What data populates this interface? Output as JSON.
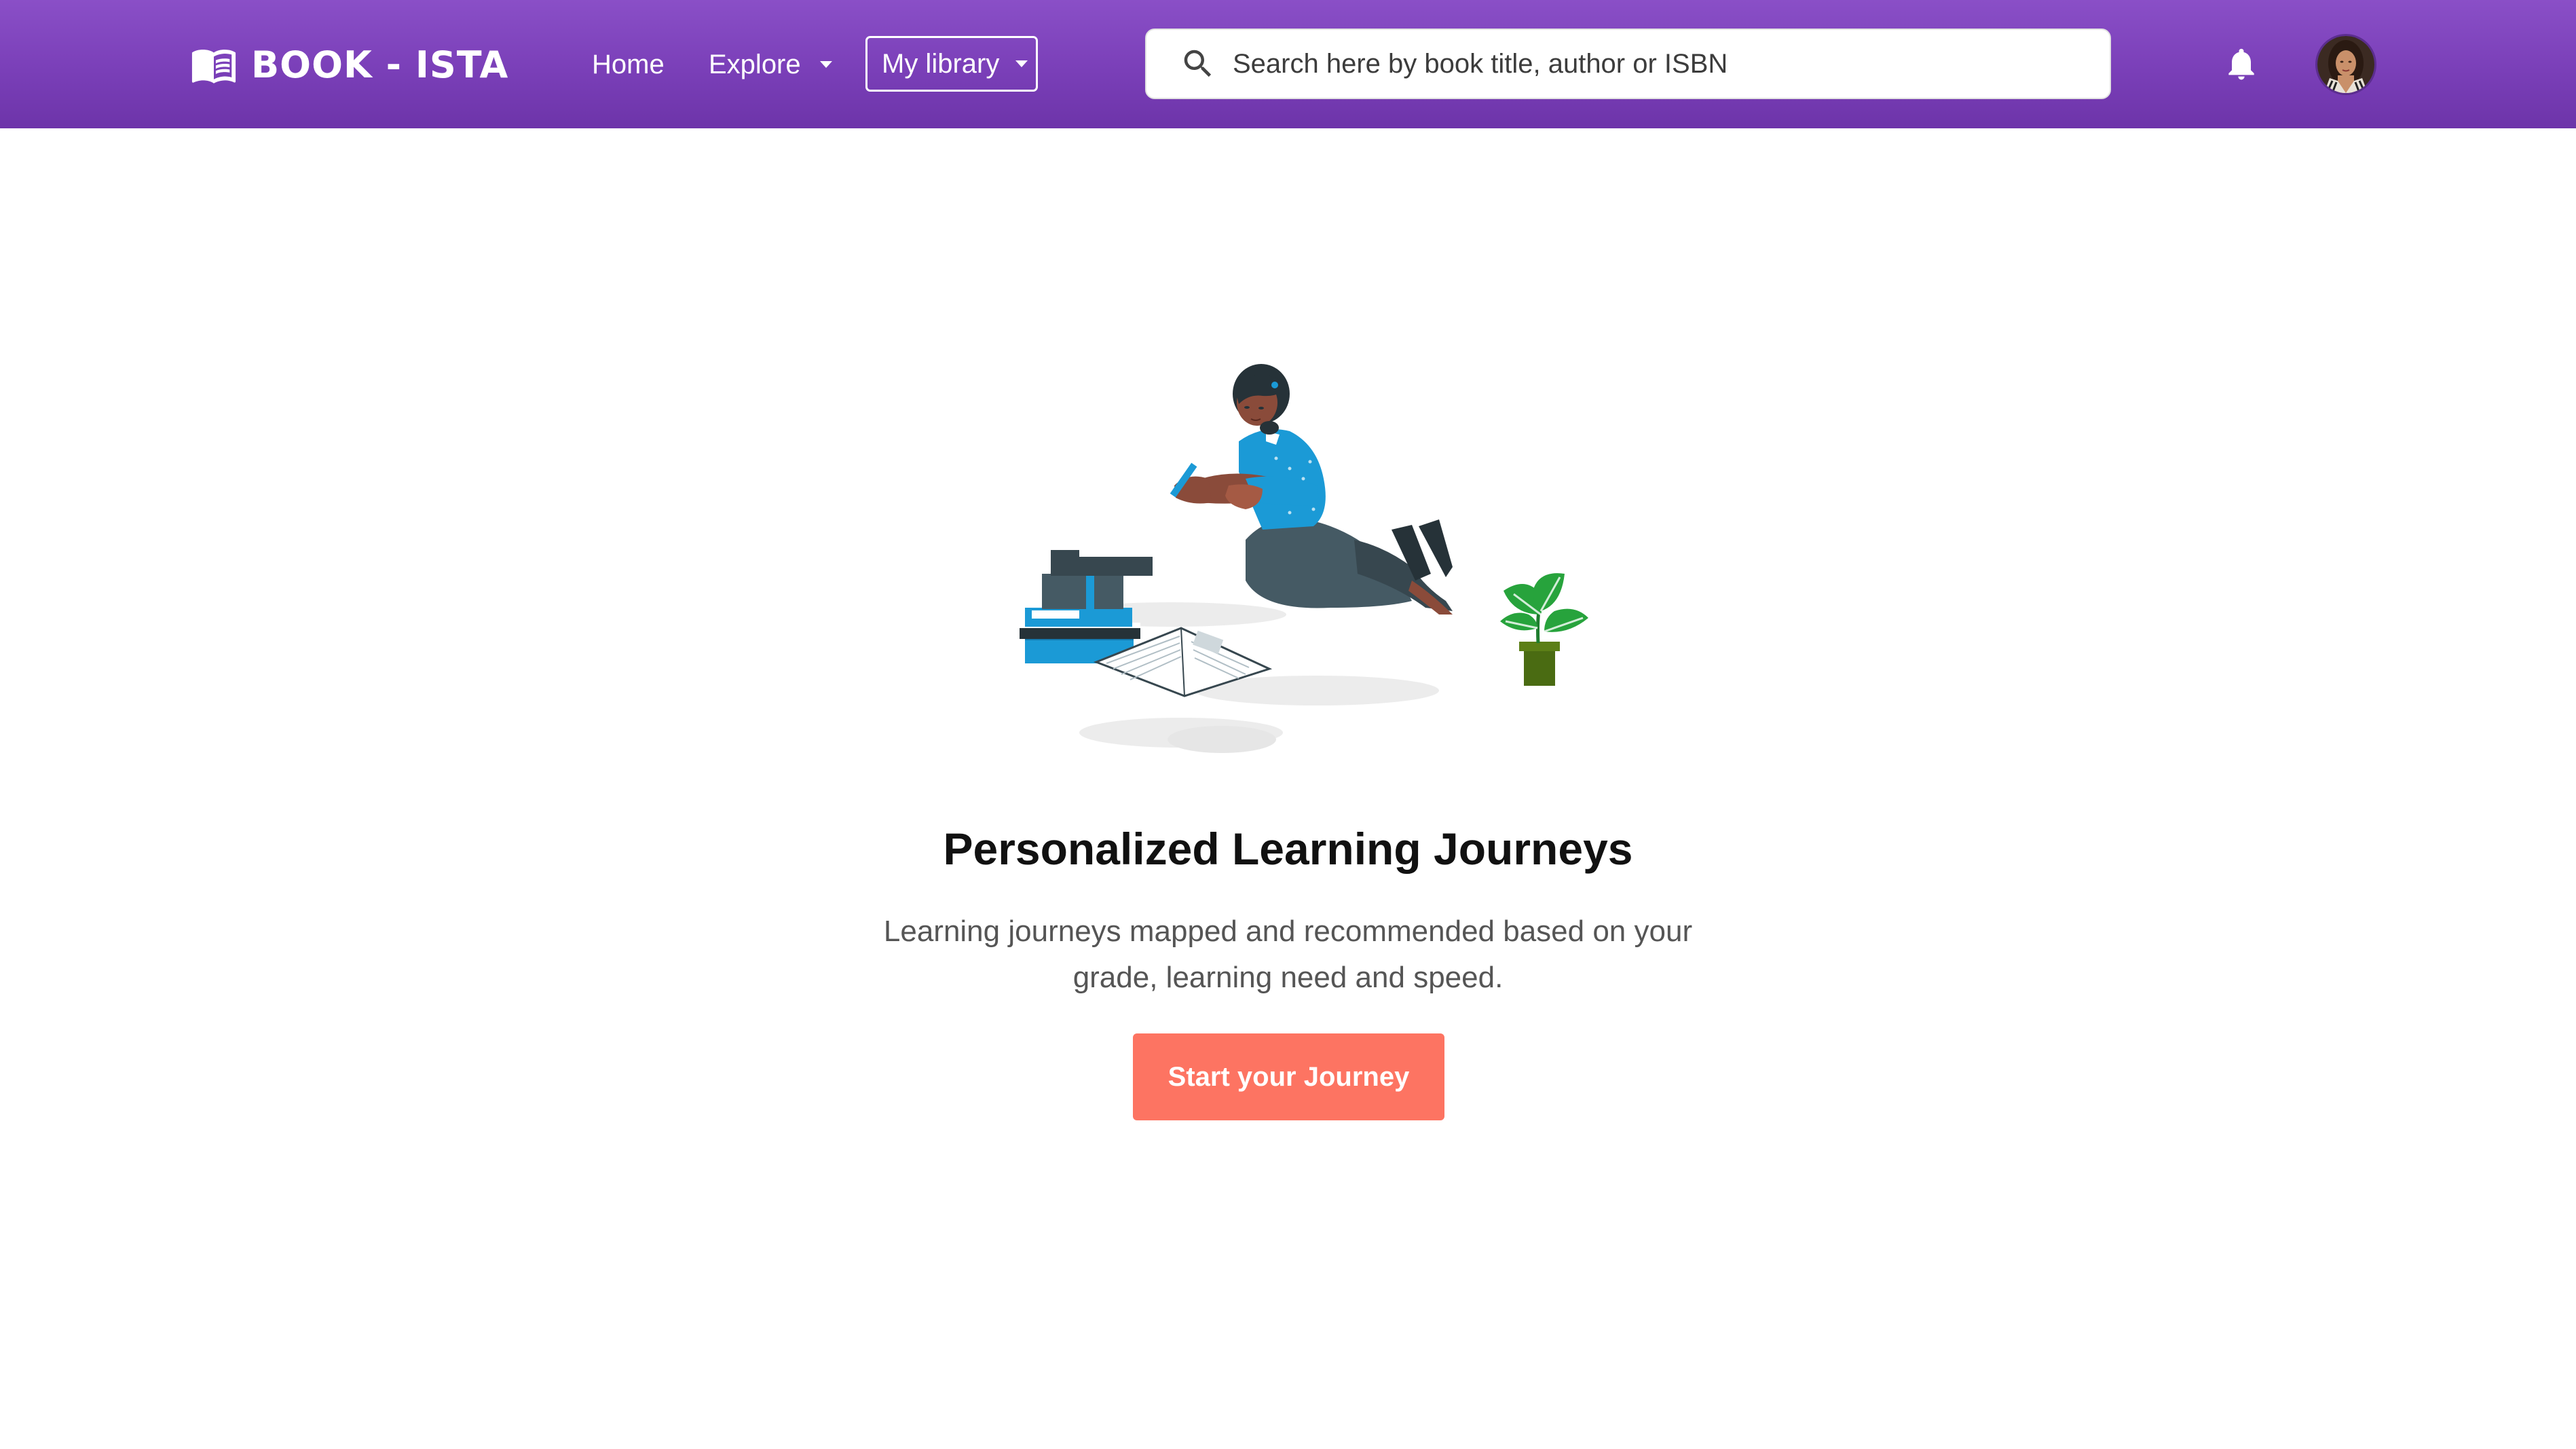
{
  "header": {
    "logo_text": "BOOK - ISTA",
    "nav": {
      "home_label": "Home",
      "explore_label": "Explore",
      "library_label": "My library"
    },
    "search": {
      "placeholder": "Search here by book title, author or ISBN",
      "icon": "search-icon"
    },
    "notification_icon": "bell-icon",
    "avatar_icon": "user-avatar"
  },
  "hero": {
    "title": "Personalized Learning Journeys",
    "description": "Learning journeys mapped and recommended based on your grade, learning need and speed.",
    "cta_label": "Start your Journey",
    "illustration": "woman-writing-with-books-and-plant"
  },
  "colors": {
    "header_purple": "#7a3fb8",
    "cta": "#fd7462",
    "illustration_blue": "#1b9ad6",
    "plant_green": "#27a33c"
  }
}
